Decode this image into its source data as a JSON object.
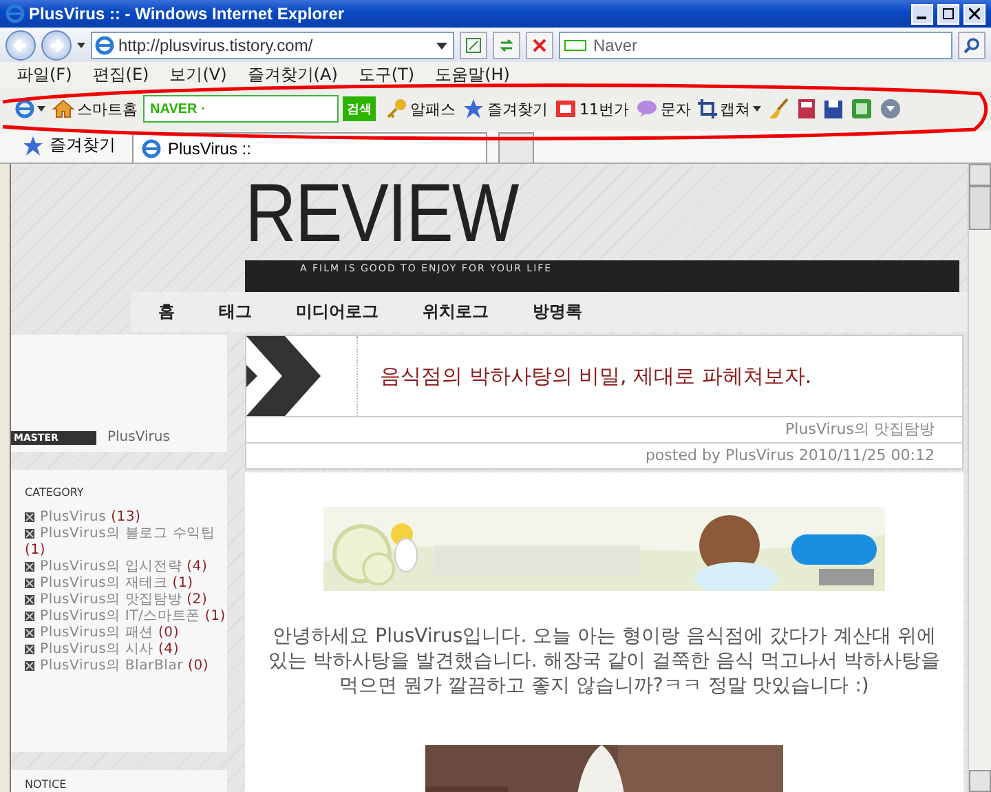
{
  "window": {
    "title": "PlusVirus :: - Windows Internet Explorer"
  },
  "address_bar": {
    "url": "http://plusvirus.tistory.com/",
    "search_placeholder": "Naver"
  },
  "menu": [
    "파일(F)",
    "편집(E)",
    "보기(V)",
    "즐겨찾기(A)",
    "도구(T)",
    "도움말(H)"
  ],
  "toolbar": [
    {
      "kind": "ie-menu"
    },
    {
      "kind": "button",
      "label": "스마트홈"
    },
    {
      "kind": "search",
      "brand": "NAVER ·",
      "button": "검색"
    },
    {
      "kind": "button",
      "label": "알패스"
    },
    {
      "kind": "button",
      "label": "즐겨찾기"
    },
    {
      "kind": "button",
      "label": "11번가"
    },
    {
      "kind": "button",
      "label": "문자"
    },
    {
      "kind": "menu-button",
      "label": "캡쳐"
    },
    {
      "kind": "icon"
    },
    {
      "kind": "icon"
    },
    {
      "kind": "icon"
    },
    {
      "kind": "icon"
    },
    {
      "kind": "icon"
    }
  ],
  "favorites_bar": {
    "label": "즐겨찾기",
    "tabs": [
      {
        "title": "PlusVirus ::",
        "selected": true
      }
    ]
  },
  "blog": {
    "title": "REVIEW",
    "tagline": "A FILM IS GOOD TO ENJOY FOR YOUR LIFE",
    "nav": [
      "홈",
      "태그",
      "미디어로그",
      "위치로그",
      "방명록"
    ],
    "profile": {
      "badge": "MASTER",
      "name": "PlusVirus"
    },
    "category": {
      "heading": "CATEGORY",
      "items": [
        {
          "name": "PlusVirus",
          "count": "(13)"
        },
        {
          "name": "PlusVirus의 블로그 수익팁",
          "count": "(1)"
        },
        {
          "name": "PlusVirus의 입시전략",
          "count": "(4)"
        },
        {
          "name": "PlusVirus의 재테크",
          "count": "(1)"
        },
        {
          "name": "PlusVirus의 맛집탐방",
          "count": "(2)"
        },
        {
          "name": "PlusVirus의 IT/스마트폰",
          "count": "(1)"
        },
        {
          "name": "PlusVirus의 패션",
          "count": "(0)"
        },
        {
          "name": "PlusVirus의 시사",
          "count": "(4)"
        },
        {
          "name": "PlusVirus의 BlarBlar",
          "count": "(0)"
        }
      ]
    },
    "notice": {
      "heading": "NOTICE"
    },
    "post": {
      "title": "음식점의 박하사탕의 비밀, 제대로 파헤쳐보자.",
      "category": "PlusVirus의 맛집탐방",
      "posted": "posted by PlusVirus 2010/11/25 00:12",
      "body": "안녕하세요 PlusVirus입니다. 오늘 아는 형이랑 음식점에 갔다가 계산대 위에 있는 박하사탕을 발견했습니다. 해장국 같이 걸쭉한 음식 먹고나서 박하사탕을 먹으면 뭔가 깔끔하고 좋지 않습니까?ㅋㅋ 정말 맛있습니다 :)"
    }
  }
}
